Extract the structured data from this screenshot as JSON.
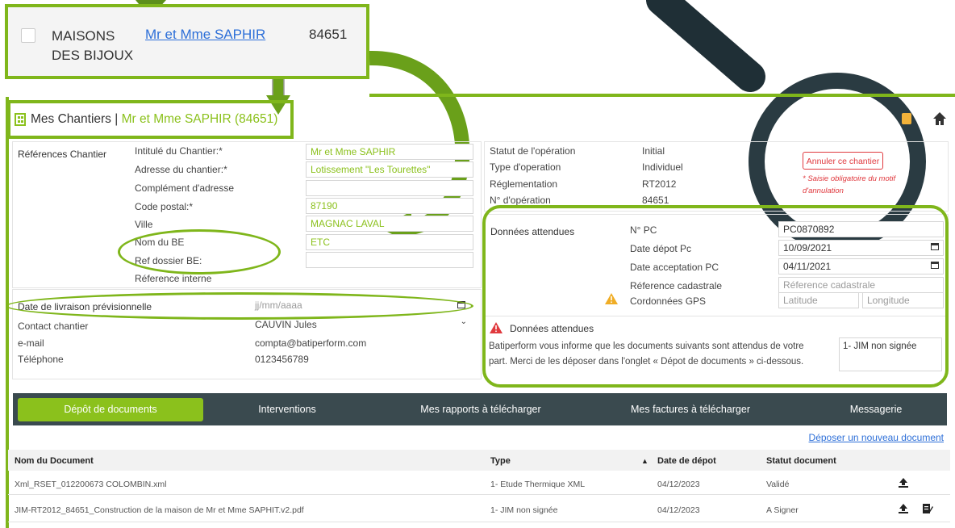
{
  "list_row": {
    "name": "MAISONS DES BIJOUX",
    "name_line1": "MAISONS",
    "name_line2": "DES BIJOUX",
    "client_link": "Mr et Mme SAPHIR",
    "code": "84651"
  },
  "header": {
    "title": "Mes Chantiers |",
    "chantier": "Mr et Mme SAPHIR (84651)"
  },
  "references": {
    "section_label": "Références Chantier",
    "fields": [
      {
        "label": "Intitulé du Chantier:*",
        "value": "Mr et Mme SAPHIR"
      },
      {
        "label": "Adresse du chantier:*",
        "value": "Lotissement \"Les Tourettes\""
      },
      {
        "label": "Complément d'adresse",
        "value": ""
      },
      {
        "label": "Code postal:*",
        "value": "87190"
      },
      {
        "label": "Ville",
        "value": "MAGNAC LAVAL"
      },
      {
        "label": "Nom du BE",
        "value": "ETC"
      },
      {
        "label": "Ref dossier BE:",
        "value": ""
      },
      {
        "label": "Réference interne",
        "value": ""
      }
    ]
  },
  "livraison": {
    "label": "Date de livraison prévisionnelle",
    "placeholder": "jj/mm/aaaa"
  },
  "contact": {
    "contact_label": "Contact chantier",
    "contact_value": "CAUVIN Jules",
    "email_label": "e-mail",
    "email_value": "compta@batiperform.com",
    "phone_label": "Téléphone",
    "phone_value": "0123456789"
  },
  "operation": {
    "rows": [
      {
        "label": "Statut de l'opération",
        "value": "Initial"
      },
      {
        "label": "Type d'operation",
        "value": "Individuel"
      },
      {
        "label": "Réglementation",
        "value": "RT2012"
      },
      {
        "label": "N° d'opération",
        "value": "84651"
      }
    ],
    "cancel_button": "Annuler ce chantier",
    "cancel_note": "* Saisie obligatoire du motif d'annulation"
  },
  "donnees": {
    "section_label": "Données attendues",
    "fields": [
      {
        "label": "N° PC",
        "value": "PC0870892"
      },
      {
        "label": "Date dépot Pc",
        "value": "10/09/2021"
      },
      {
        "label": "Date acceptation PC",
        "value": "04/11/2021"
      },
      {
        "label": "Réference cadastrale",
        "placeholder": "Réference cadastrale"
      },
      {
        "label": "Cordonnées GPS",
        "placeholder_lat": "Latitude",
        "placeholder_lon": "Longitude"
      }
    ],
    "alert_title": "Données attendues",
    "alert_text_1": "Batiperform vous informe que les documents suivants sont attendus de votre",
    "alert_text_2": "part. Merci de les déposer dans l'onglet « Dépot de documents » ci-dessous.",
    "alert_box_value": "1- JIM non signée"
  },
  "tabs": [
    "Dépôt de documents",
    "Interventions",
    "Mes rapports à télécharger",
    "Mes factures à télécharger",
    "Messagerie"
  ],
  "upload_link": "Déposer un nouveau document",
  "table": {
    "headers": {
      "name": "Nom du Document",
      "type": "Type",
      "date": "Date de dépot",
      "status": "Statut document"
    },
    "rows": [
      {
        "name": "Xml_RSET_012200673 COLOMBIN.xml",
        "type": "1- Etude Thermique XML",
        "date": "04/12/2023",
        "status": "Validé"
      },
      {
        "name": "JIM-RT2012_84651_Construction de la maison de Mr et Mme SAPHIT.v2.pdf",
        "type": "1- JIM non signée",
        "date": "04/12/2023",
        "status": "A Signer"
      }
    ]
  },
  "colors": {
    "accent": "#8bc11c",
    "annotation": "#7fb61b",
    "tabbar": "#3a4a4f",
    "danger": "#e0393e"
  }
}
